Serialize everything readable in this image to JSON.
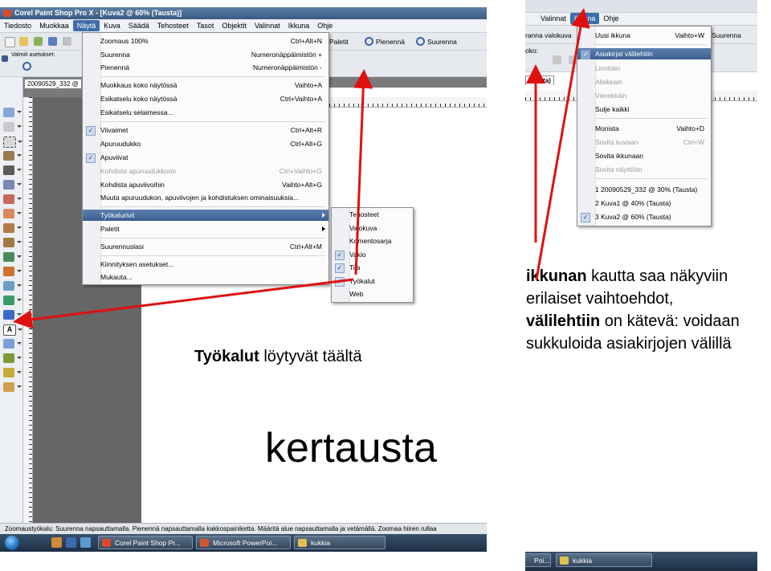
{
  "left_window": {
    "title": "Corel Paint Shop Pro X - [Kuva2 @ 60% (Tausta)]",
    "menubar": [
      "Tiedosto",
      "Muokkaa",
      "Näytä",
      "Kuva",
      "Säädä",
      "Tehosteet",
      "Tasot",
      "Objektit",
      "Valinnat",
      "Ikkuna",
      "Ohje"
    ],
    "active_menu": "Näytä",
    "toolbar_labels": {
      "presets": "Valmiit asetukset:",
      "palette": "Paletit",
      "zoom_out": "Pienennä",
      "zoom_in": "Suurenna"
    },
    "doc_tab": "20090529_332 @",
    "status": "Zoomaustyökalu: Suurenna napsauttamalla. Pienennä napsauttamalla kakkospainiketta. Määritä alue napsauttamalla ja vetämällä. Zoomaa hiiren rullaa",
    "taskbar": [
      "Corel Paint Shop Pr...",
      "Microsoft PowerPoi...",
      "kukkia"
    ]
  },
  "view_menu": {
    "items": [
      {
        "label": "Zoomaus 100%",
        "shortcut": "Ctrl+Alt+N"
      },
      {
        "label": "Suurenna",
        "shortcut": "Numeronäppäimistön +"
      },
      {
        "label": "Pienennä",
        "shortcut": "Numeronäppäimistön -"
      },
      {
        "label": "Muokkaus koko näytössä",
        "shortcut": "Vaihto+A"
      },
      {
        "label": "Esikatselu koko näytössä",
        "shortcut": "Ctrl+Vaihto+A"
      },
      {
        "label": "Esikatselu selaimessa...",
        "shortcut": ""
      },
      {
        "label": "Viivaimet",
        "shortcut": "Ctrl+Alt+R",
        "checked": true
      },
      {
        "label": "Apuruudukko",
        "shortcut": "Ctrl+Alt+G"
      },
      {
        "label": "Apuviivat",
        "shortcut": "",
        "checked": true
      },
      {
        "label": "Kohdista apuruudukkoon",
        "shortcut": "Ctrl+Vaihto+G",
        "disabled": true
      },
      {
        "label": "Kohdista apuviivoihin",
        "shortcut": "Vaihto+Alt+G"
      },
      {
        "label": "Muuta apuruudukon, apuviivojen ja kohdistuksen ominaisuuksia...",
        "shortcut": ""
      },
      {
        "label": "Työkalurivit",
        "shortcut": "",
        "highlighted": true,
        "submenu": true
      },
      {
        "label": "Paletit",
        "shortcut": "",
        "submenu": true
      },
      {
        "label": "Suurennuslasi",
        "shortcut": "Ctrl+Alt+M"
      },
      {
        "label": "Kiinnityksen asetukset...",
        "shortcut": ""
      },
      {
        "label": "Mukauta...",
        "shortcut": ""
      }
    ]
  },
  "toolbars_submenu": {
    "items": [
      {
        "label": "Tehosteet",
        "checked": false
      },
      {
        "label": "Valokuva",
        "checked": false
      },
      {
        "label": "Komentosarja",
        "checked": false
      },
      {
        "label": "Vakio",
        "checked": true
      },
      {
        "label": "Tila",
        "checked": true
      },
      {
        "label": "Työkalut",
        "checked": true
      },
      {
        "label": "Web",
        "checked": false
      }
    ]
  },
  "right_window": {
    "menubar": [
      "Valinnat",
      "Ikkuna",
      "Ohje"
    ],
    "active_menu": "Ikkuna",
    "side_texts": {
      "left_top": "ranna valokuva",
      "left_mid": "oko:",
      "right_top": "Suurenna",
      "doc_tab": "Tausta)"
    },
    "taskbar": [
      "Poi...",
      "kukkia"
    ]
  },
  "window_menu": {
    "items": [
      {
        "label": "Uusi ikkuna",
        "shortcut": "Vaihto+W"
      },
      {
        "label": "Asiakirjat välilehtiin",
        "shortcut": "",
        "checked": true,
        "highlighted": true
      },
      {
        "label": "Limittäin",
        "shortcut": "",
        "disabled": true
      },
      {
        "label": "Allekkain",
        "shortcut": "",
        "disabled": true
      },
      {
        "label": "Vierekkäin",
        "shortcut": "",
        "disabled": true
      },
      {
        "label": "Sulje kaikki",
        "shortcut": ""
      },
      {
        "label": "Monista",
        "shortcut": "Vaihto+D"
      },
      {
        "label": "Sovita kuvaan",
        "shortcut": "Ctrl+W",
        "disabled": true
      },
      {
        "label": "Sovita ikkunaan",
        "shortcut": ""
      },
      {
        "label": "Sovita näyttöön",
        "shortcut": "",
        "disabled": true
      },
      {
        "label": "1 20090529_332 @ 30% (Tausta)",
        "shortcut": ""
      },
      {
        "label": "2 Kuva1 @ 40% (Tausta)",
        "shortcut": ""
      },
      {
        "label": "3 Kuva2 @ 60% (Tausta)",
        "shortcut": "",
        "checked": true
      }
    ]
  },
  "annotations": {
    "tools_bold": "Työkalut",
    "tools_rest": " löytyvät täältä",
    "tabs_line1_bold": "ikkunan",
    "tabs_line1_rest": " kautta saa näkyviin",
    "tabs_line2": "erilaiset vaihtoehdot,",
    "tabs_line3_bold": "välilehtiin",
    "tabs_line3_rest": " on kätevä: voidaan",
    "tabs_line4": "sukkuloida asiakirjojen välillä",
    "big_word": "kertausta"
  },
  "colors": {
    "arrow": "#e01010",
    "menu_highlight": "#3b5e90",
    "title_bar": "#3b5a82"
  }
}
